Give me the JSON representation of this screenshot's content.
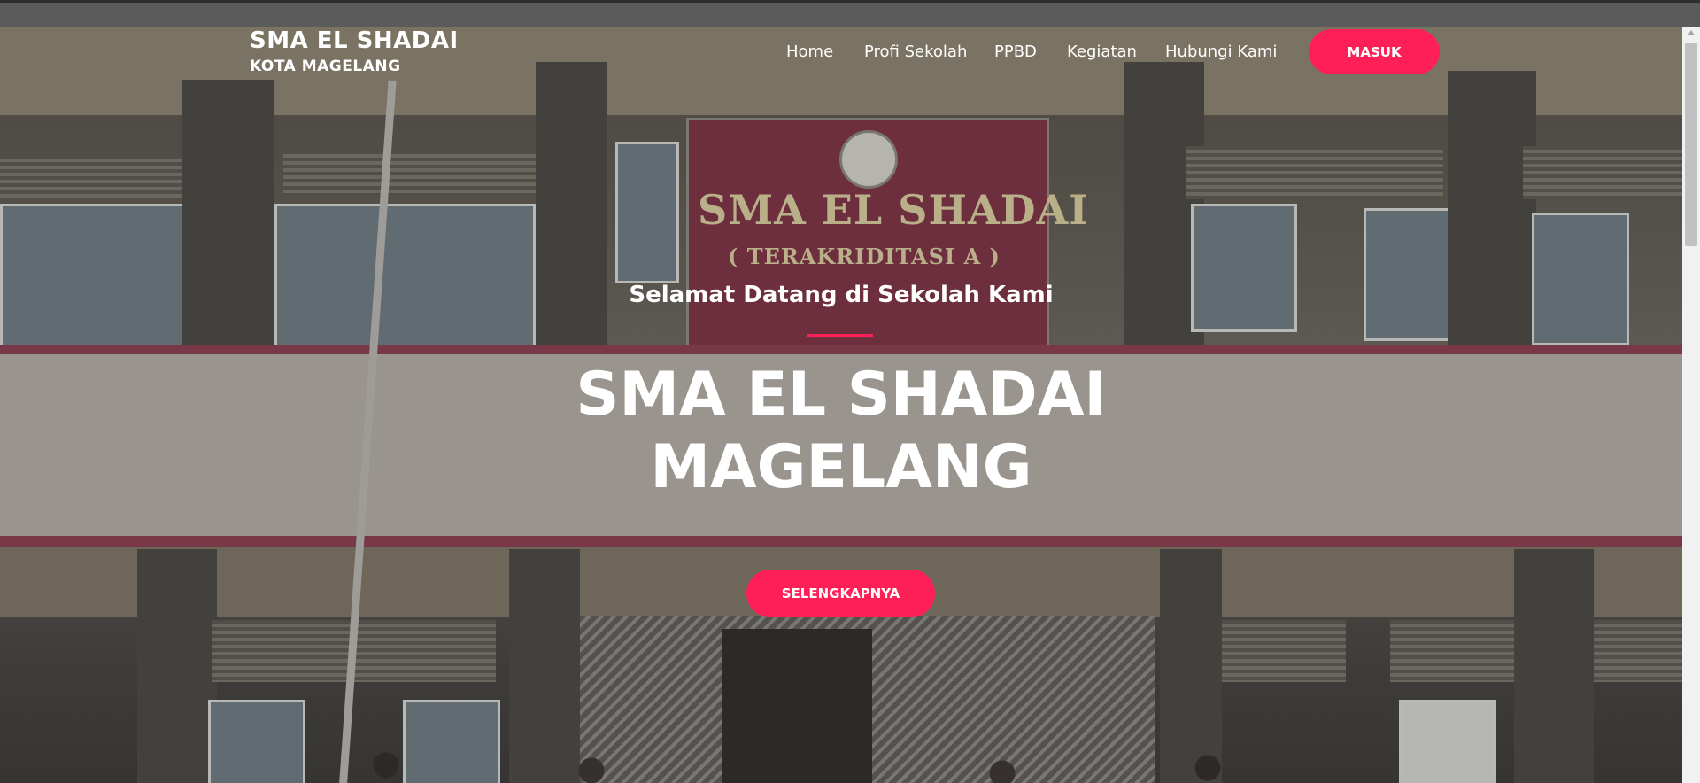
{
  "brand": {
    "title": "SMA EL SHADAI",
    "subtitle": "KOTA MAGELANG"
  },
  "nav": {
    "items": [
      {
        "label": "Home"
      },
      {
        "label": "Profi Sekolah"
      },
      {
        "label": "PPBD"
      },
      {
        "label": "Kegiatan"
      },
      {
        "label": "Hubungi Kami"
      }
    ],
    "login_label": "MASUK"
  },
  "hero": {
    "subtitle": "Selamat Datang di Sekolah Kami",
    "title_line1": "SMA EL SHADAI",
    "title_line2": "MAGELANG",
    "cta_label": "SELENGKAPNYA",
    "sign_text": "SMA EL SHADAI",
    "sign_subtext": "( TERAKRIDITASI A )"
  },
  "colors": {
    "accent": "#ff1f57",
    "text": "#ffffff"
  }
}
